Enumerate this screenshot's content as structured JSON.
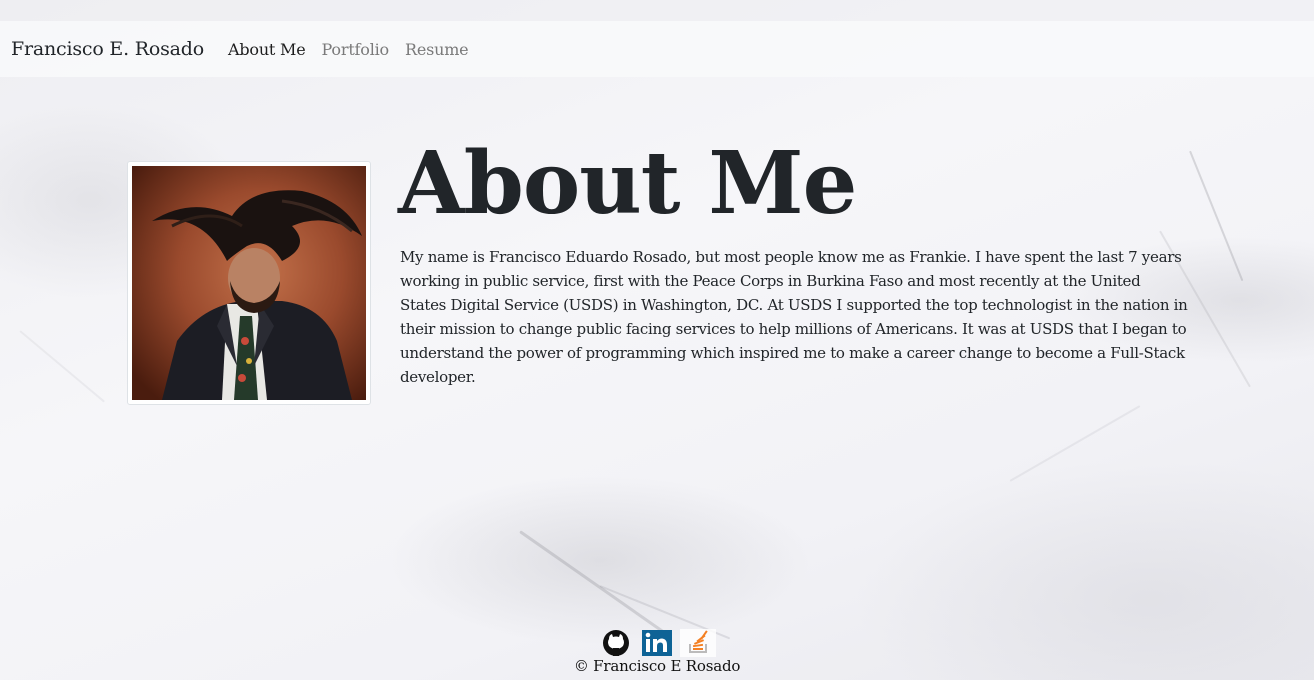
{
  "navbar": {
    "brand": "Francisco E. Rosado",
    "links": [
      {
        "label": "About Me",
        "active": true
      },
      {
        "label": "Portfolio",
        "active": false
      },
      {
        "label": "Resume",
        "active": false
      }
    ]
  },
  "main": {
    "title": "About Me",
    "bio": "My name is Francisco Eduardo Rosado, but most people know me as Frankie. I have spent the last 7 years working in public service, first with the Peace Corps in Burkina Faso and most recently at the United States Digital Service (USDS) in Washington, DC. At USDS I supported the top technologist in the nation in their mission to change public facing services to help millions of Americans. It was at USDS that I began to understand the power of programming which inspired me to make a career change to become a Full-Stack developer.",
    "photo_icon": "profile-photo"
  },
  "footer": {
    "social": [
      {
        "name": "github-icon",
        "color": "#111111"
      },
      {
        "name": "linkedin-icon",
        "color": "#0e6396"
      },
      {
        "name": "stack-overflow-icon",
        "color": "#f48024"
      }
    ],
    "copyright": "© Francisco E Rosado"
  },
  "colors": {
    "navbar_bg": "#f8f9fa",
    "text": "#212529",
    "nav_inactive": "#7a7a7a"
  }
}
